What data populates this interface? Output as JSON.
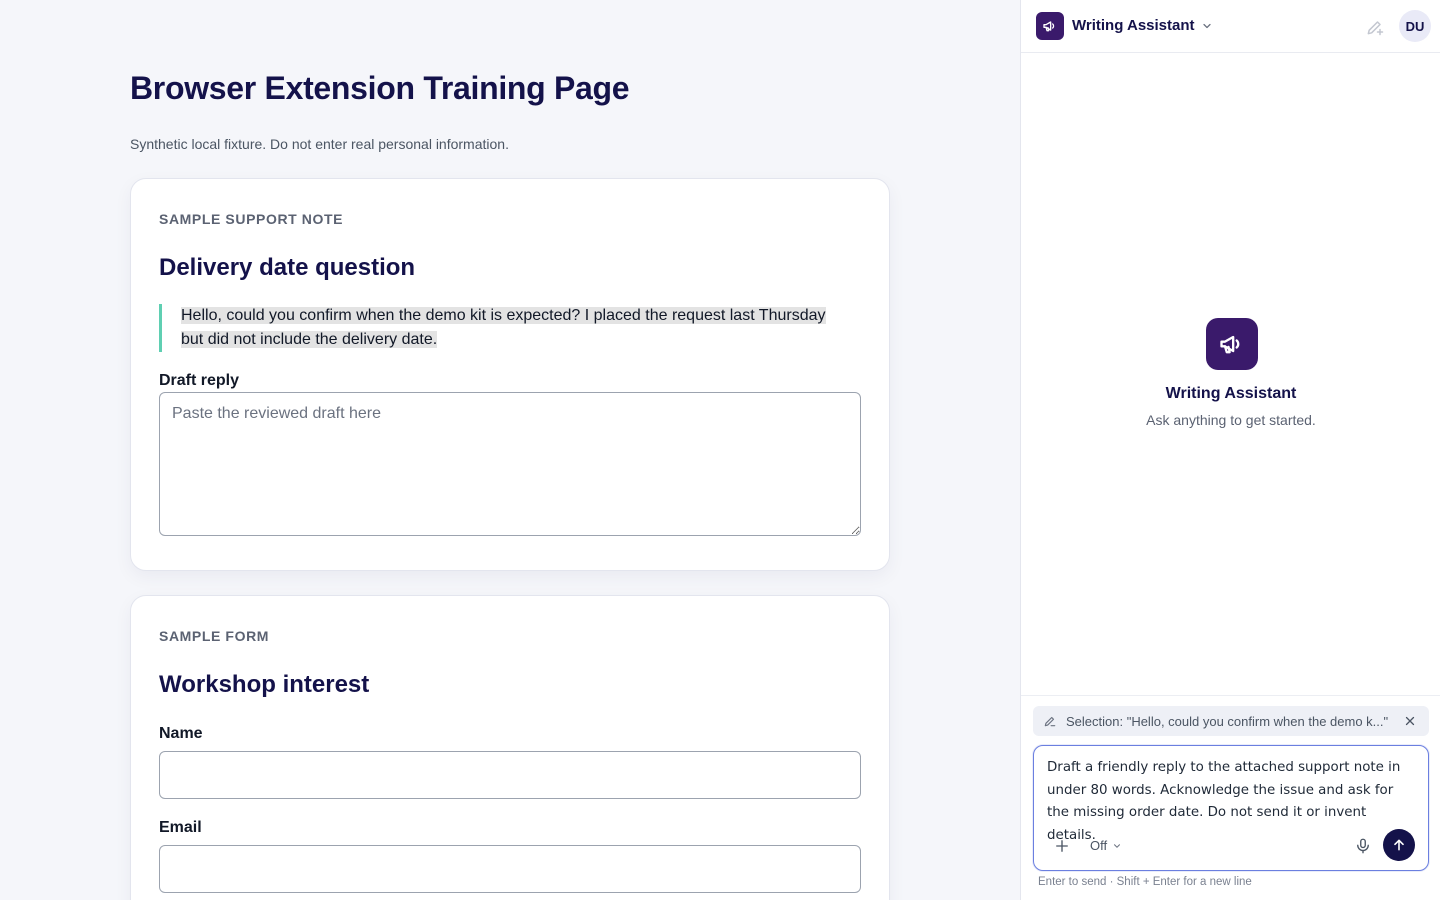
{
  "page": {
    "title": "Browser Extension Training Page",
    "subtitle": "Synthetic local fixture. Do not enter real personal information."
  },
  "support_card": {
    "eyebrow": "SAMPLE SUPPORT NOTE",
    "title": "Delivery date question",
    "quote": "Hello, could you confirm when the demo kit is expected? I placed the request last Thursday but did not include the delivery date.",
    "draft_label": "Draft reply",
    "draft_placeholder": "Paste the reviewed draft here",
    "draft_value": ""
  },
  "form_card": {
    "eyebrow": "SAMPLE FORM",
    "title": "Workshop interest",
    "name_label": "Name",
    "name_value": "",
    "email_label": "Email",
    "email_value": ""
  },
  "assistant": {
    "name": "Writing Assistant",
    "avatar_initials": "DU",
    "empty_title": "Writing Assistant",
    "empty_subtitle": "Ask anything to get started.",
    "selection_chip": "Selection: \"Hello, could you confirm when the demo k...\"",
    "composer_text": "Draft a friendly reply to the attached support note in under 80 words. Acknowledge the issue and ask for the missing order date. Do not send it or invent details.",
    "mode_label": "Off",
    "hint": "Enter to send · Shift + Enter for a new line"
  },
  "icons": {
    "logo": "megaphone-icon",
    "dropdown": "chevron-down-icon",
    "new_chat": "pencil-plus-icon",
    "selection": "pencil-icon",
    "close": "close-icon",
    "attach": "plus-icon",
    "microphone": "microphone-icon",
    "send": "arrow-up-icon"
  },
  "colors": {
    "brand": "#3a1a6b",
    "heading": "#14124a",
    "quote_accent": "#5fcfb2",
    "send_button": "#14124a",
    "composer_focus": "#6b7fe0"
  }
}
